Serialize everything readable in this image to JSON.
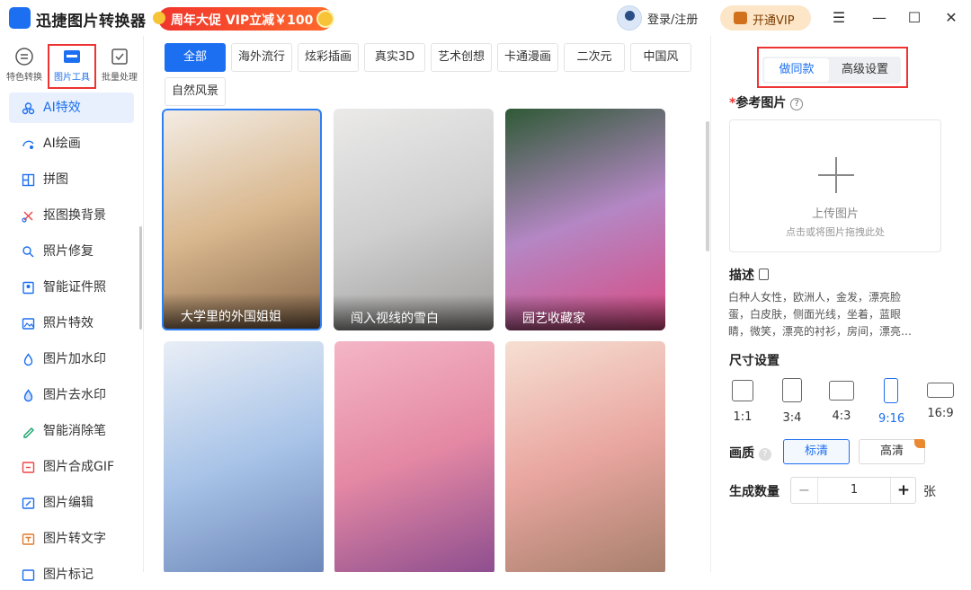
{
  "app": {
    "title": "迅捷图片转换器",
    "promo": "周年大促 VIP立减￥100",
    "login": "登录/注册",
    "vip": "开通VIP"
  },
  "categories": [
    {
      "label": "特色转换",
      "icon": "convert-icon"
    },
    {
      "label": "图片工具",
      "icon": "image-tool-icon"
    },
    {
      "label": "批量处理",
      "icon": "batch-icon"
    }
  ],
  "sidebar": {
    "items": [
      {
        "label": "AI特效",
        "icon": "ai-effect-icon"
      },
      {
        "label": "AI绘画",
        "icon": "ai-paint-icon"
      },
      {
        "label": "拼图",
        "icon": "collage-icon"
      },
      {
        "label": "抠图换背景",
        "icon": "cutout-icon"
      },
      {
        "label": "照片修复",
        "icon": "repair-icon"
      },
      {
        "label": "智能证件照",
        "icon": "id-photo-icon"
      },
      {
        "label": "照片特效",
        "icon": "photo-effect-icon"
      },
      {
        "label": "图片加水印",
        "icon": "add-watermark-icon"
      },
      {
        "label": "图片去水印",
        "icon": "remove-watermark-icon"
      },
      {
        "label": "智能消除笔",
        "icon": "eraser-icon"
      },
      {
        "label": "图片合成GIF",
        "icon": "gif-icon"
      },
      {
        "label": "图片编辑",
        "icon": "edit-icon"
      },
      {
        "label": "图片转文字",
        "icon": "ocr-icon"
      },
      {
        "label": "图片标记",
        "icon": "mark-icon"
      }
    ]
  },
  "tabs": [
    "全部",
    "海外流行",
    "炫彩插画",
    "真实3D",
    "艺术创想",
    "卡通漫画",
    "二次元",
    "中国风",
    "自然风景"
  ],
  "cards": [
    {
      "title": "大学里的外国姐姐",
      "colors": [
        "#f3ece4",
        "#d9b88f",
        "#8a6a4c"
      ]
    },
    {
      "title": "闯入视线的雪白",
      "colors": [
        "#ebeae9",
        "#cfcfd0",
        "#9d9b99"
      ]
    },
    {
      "title": "园艺收藏家",
      "colors": [
        "#2f5a36",
        "#b487c4",
        "#d94a82"
      ]
    },
    {
      "title": "",
      "colors": [
        "#e9eef6",
        "#a9c4e8",
        "#6c86b8"
      ]
    },
    {
      "title": "",
      "colors": [
        "#f4b6c6",
        "#e488a4",
        "#8c4d8e"
      ]
    },
    {
      "title": "",
      "colors": [
        "#f6dfd2",
        "#e9a6a0",
        "#a67f6b"
      ]
    }
  ],
  "panel": {
    "seg": [
      "做同款",
      "高级设置"
    ],
    "ref_label": "参考图片",
    "upload_title": "上传图片",
    "upload_hint": "点击或将图片拖拽此处",
    "desc_label": "描述",
    "desc_text": "白种人女性，欧洲人，金发，漂亮脸蛋，白皮肤，侧面光线，坐着，蓝眼睛，微笑，漂亮的衬衫，房间，漂亮…",
    "size_label": "尺寸设置",
    "sizes": [
      "1:1",
      "3:4",
      "4:3",
      "9:16",
      "16:9"
    ],
    "quality_label": "画质",
    "quality": [
      "标清",
      "高清"
    ],
    "count_label": "生成数量",
    "count": "1",
    "unit": "张",
    "minus": "−",
    "plus": "+"
  },
  "colors": {
    "accent": "#1c6ff0",
    "promo": "#f0352c",
    "highlight": "#e33"
  }
}
